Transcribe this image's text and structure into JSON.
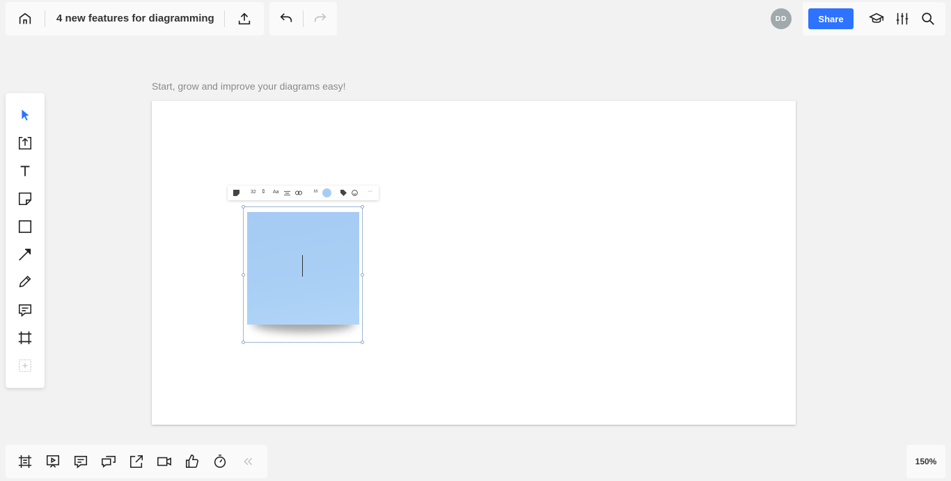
{
  "header": {
    "board_title": "4 new features for diagramming",
    "avatar_initials": "DD",
    "share_label": "Share"
  },
  "canvas": {
    "frame_label": "Start, grow and improve your diagrams easy!",
    "sticky_toolbar": {
      "font_size": "32",
      "font_label": "Aa",
      "size_label": "M",
      "more_label": "···",
      "sticky_color": "#a8cdf4"
    }
  },
  "left_toolbar": {
    "tools": [
      "select",
      "upload",
      "text",
      "sticky-note",
      "shape",
      "connection-line",
      "pen",
      "comment",
      "frame",
      "more-tools"
    ]
  },
  "bottom_toolbar": {
    "tools": [
      "frames",
      "presentation",
      "comments",
      "chat",
      "share-screen",
      "video-call",
      "voting",
      "timer",
      "collapse"
    ]
  },
  "zoom": {
    "level": "150%"
  },
  "colors": {
    "accent": "#2d73ff",
    "select_tool": "#2d73ff",
    "sticky": "#a8cdf4"
  }
}
